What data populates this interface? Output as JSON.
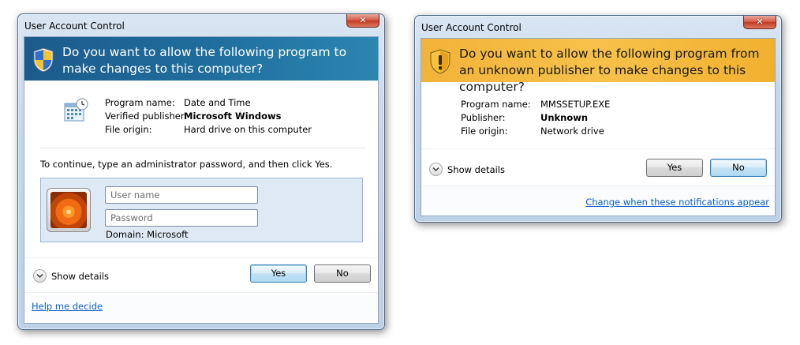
{
  "dialog1": {
    "title": "User Account Control",
    "close_glyph": "✕",
    "heading": "Do you want to allow the following program to make changes to this computer?",
    "program_label": "Program name:",
    "program_value": "Date and Time",
    "publisher_label": "Verified publisher:",
    "publisher_value": "Microsoft Windows",
    "origin_label": "File origin:",
    "origin_value": "Hard drive on this computer",
    "instruction": "To continue, type an administrator password, and then click Yes.",
    "username_placeholder": "User name",
    "password_placeholder": "Password",
    "domain": "Domain: Microsoft",
    "show_details": "Show details",
    "yes": "Yes",
    "no": "No",
    "help_link": "Help me decide",
    "header_color": "#1f6d9c",
    "icons": {
      "shield": "uac-shield-icon",
      "program": "date-time-icon",
      "chevron": "chevron-down-icon"
    }
  },
  "dialog2": {
    "title": "User Account Control",
    "close_glyph": "✕",
    "heading": "Do you want to allow the following program from an unknown publisher to make changes to this computer?",
    "program_label": "Program name:",
    "program_value": "MMSSETUP.EXE",
    "publisher_label": "Publisher:",
    "publisher_value": "Unknown",
    "origin_label": "File origin:",
    "origin_value": "Network drive",
    "show_details": "Show details",
    "yes": "Yes",
    "no": "No",
    "notifications_link": "Change when these notifications appear",
    "header_color": "#f6c14a",
    "icons": {
      "shield": "warning-shield-icon",
      "chevron": "chevron-down-icon"
    }
  }
}
